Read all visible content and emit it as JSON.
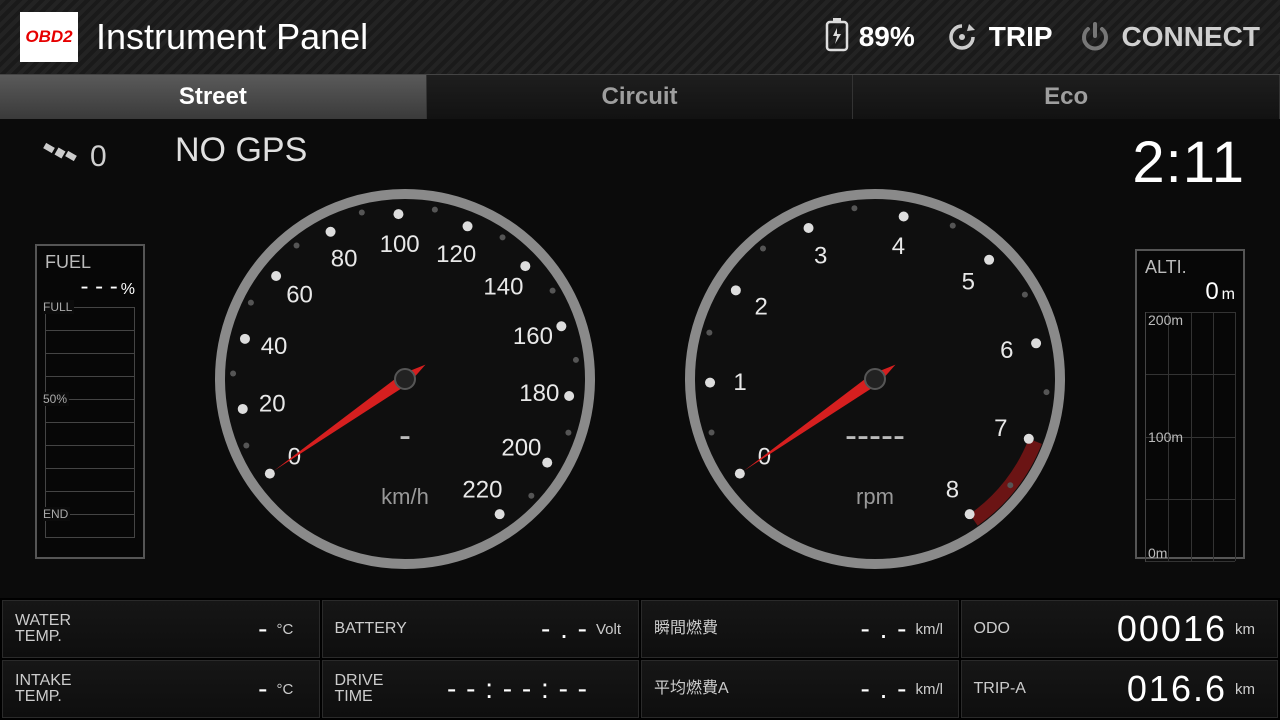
{
  "header": {
    "logo_text": "OBD2",
    "title": "Instrument Panel",
    "battery_pct": "89%",
    "trip_label": "TRIP",
    "connect_label": "CONNECT"
  },
  "tabs": [
    {
      "label": "Street",
      "active": true
    },
    {
      "label": "Circuit",
      "active": false
    },
    {
      "label": "Eco",
      "active": false
    }
  ],
  "status": {
    "sat_count": "0",
    "gps_status": "NO GPS",
    "clock": "2:11"
  },
  "fuel_gauge": {
    "label": "FUEL",
    "value": "- - -",
    "unit": "%",
    "marks": [
      "FULL",
      "",
      "",
      "",
      "50%",
      "",
      "",
      "",
      "",
      "END"
    ]
  },
  "alti_gauge": {
    "label": "ALTI.",
    "value": "0",
    "unit": "m",
    "ticks": [
      {
        "label": "200m",
        "pos": 0
      },
      {
        "label": "100m",
        "pos": 50
      },
      {
        "label": "0m",
        "pos": 100
      }
    ]
  },
  "speed_gauge": {
    "ticks": [
      "0",
      "20",
      "40",
      "60",
      "80",
      "100",
      "120",
      "140",
      "160",
      "180",
      "200",
      "220"
    ],
    "center_value": "-",
    "unit": "km/h",
    "needle_value": 0,
    "max": 220
  },
  "rpm_gauge": {
    "ticks": [
      "0",
      "1",
      "2",
      "3",
      "4",
      "5",
      "6",
      "7",
      "8"
    ],
    "center_value": "-----",
    "unit": "rpm",
    "needle_value": 0,
    "max": 8,
    "redline_from": 7
  },
  "tiles": [
    {
      "label": "WATER\nTEMP.",
      "value": "-",
      "unit": "°C"
    },
    {
      "label": "BATTERY",
      "value": "- . -",
      "unit": "Volt"
    },
    {
      "label": "瞬間燃費",
      "value": "- . -",
      "unit": "km/l"
    },
    {
      "label": "ODO",
      "value": "00016",
      "unit": "km",
      "big": true
    },
    {
      "label": "INTAKE\nTEMP.",
      "value": "-",
      "unit": "°C"
    },
    {
      "label": "DRIVE\nTIME",
      "value": "- - : - - : - -",
      "unit": ""
    },
    {
      "label": "平均燃費A",
      "value": "- . -",
      "unit": "km/l"
    },
    {
      "label": "TRIP-A",
      "value": "016.6",
      "unit": "km",
      "big": true
    }
  ]
}
